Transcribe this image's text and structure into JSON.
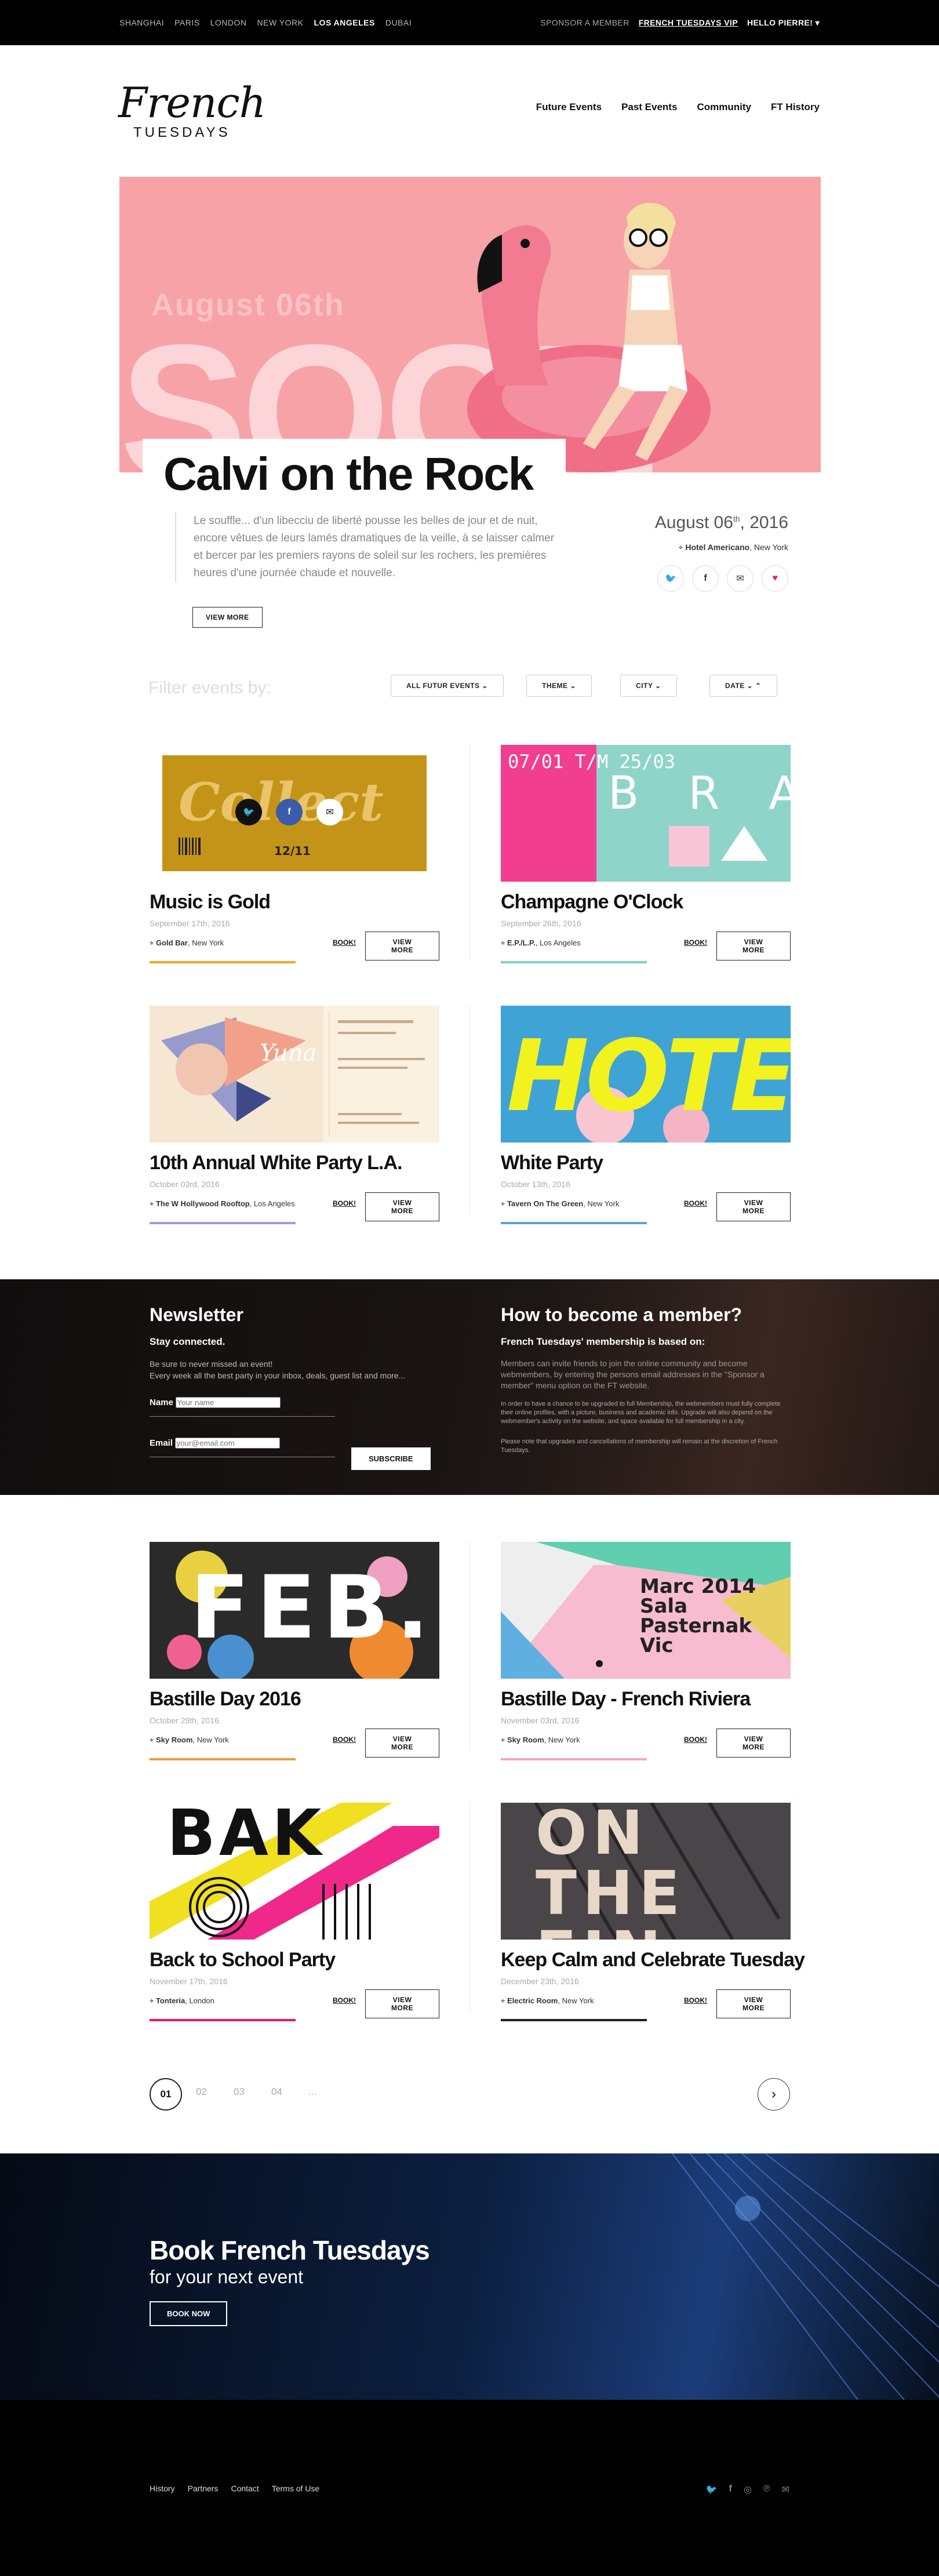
{
  "topbar": {
    "cities": [
      "SHANGHAI",
      "PARIS",
      "LONDON",
      "NEW YORK",
      "LOS ANGELES",
      "DUBAI"
    ],
    "active_city": "LOS ANGELES",
    "sponsor": "SPONSOR A MEMBER",
    "vip": "FRENCH TUESDAYS VIP",
    "hello": "HELLO PIERRE!"
  },
  "logo": {
    "line1": "French",
    "line2": "TUESDAYS"
  },
  "nav": [
    "Future Events",
    "Past Events",
    "Community",
    "FT History"
  ],
  "hero": {
    "ghost_date": "August 06th",
    "ghost_word": "SOON",
    "title": "Calvi on the Rock",
    "excerpt": "Le souffle... d'un libecciu de liberté pousse les belles de jour et de nuit, encore vêtues de leurs lamés dramatiques de la veille, à se laisser calmer et bercer par les premiers rayons de soleil sur les rochers, les premières heures d'une journée chaude et nouvelle.",
    "view_more": "VIEW MORE",
    "date_main": "August 06",
    "date_sup": "th",
    "date_year": ", 2016",
    "venue": "Hotel Americano",
    "city": ", New York"
  },
  "filter": {
    "label": "Filter events by:",
    "dropdowns": [
      "ALL FUTUR EVENTS",
      "THEME",
      "CITY",
      "DATE"
    ]
  },
  "events": [
    {
      "title": "Music is Gold",
      "date": "September 17th, 2016",
      "venue": "Gold Bar",
      "city": ", New York",
      "color": "#f5a623"
    },
    {
      "title": "Champagne O'Clock",
      "date": "September 26th, 2016",
      "venue": "E.P./L.P.",
      "city": ", Los Angeles",
      "color": "#7ed3c1"
    },
    {
      "title": "10th Annual White Party L.A.",
      "date": "October 03rd, 2016",
      "venue": "The W Hollywood Rooftop",
      "city": ", Los Angeles",
      "color": "#9a9fd6"
    },
    {
      "title": "White Party",
      "date": "October 13th, 2016",
      "venue": "Tavern On The Green",
      "city": ", New York",
      "color": "#5da3d8"
    },
    {
      "title": "Bastille Day 2016",
      "date": "October 29th, 2016",
      "venue": "Sky Room",
      "city": ", New York",
      "color": "#f29a3a"
    },
    {
      "title": "Bastille Day - French Riviera",
      "date": "November 03rd, 2016",
      "venue": "Sky Room",
      "city": ", New York",
      "color": "#f7a6b8"
    },
    {
      "title": "Back to School Party",
      "date": "November 17th, 2016",
      "venue": "Tonteria",
      "city": ", London",
      "color": "#e8196a"
    },
    {
      "title": "Keep Calm and Celebrate Tuesday",
      "date": "December 23th, 2016",
      "venue": "Electric Room",
      "city": ", New York",
      "color": "#222222"
    }
  ],
  "card_labels": {
    "book": "BOOK!",
    "view_more": "VIEW MORE"
  },
  "card_art": {
    "collect_word": "Collect",
    "collect_num": "12/11",
    "champagne_text": "07/01 T/M 25/03",
    "champagne_letters": "B R A B A N T S",
    "white_party_word": "Yuna",
    "hotel_word": "HOTEL",
    "feb_word": "FEB.",
    "marc_text": "Marc 2014 Sala Pasternak Vic",
    "back_word": "BAK",
    "onthe_word": "ON THE FIN"
  },
  "newsletter": {
    "title": "Newsletter",
    "stay": "Stay connected.",
    "desc1": "Be sure to never missed an event!",
    "desc2": "Every week all the best party in your inbox, deals, guest list and more...",
    "name_label": "Name",
    "name_placeholder": "Your name",
    "email_label": "Email",
    "email_placeholder": "your@email.com",
    "subscribe": "SUBSCRIBE"
  },
  "member": {
    "title": "How to become a member?",
    "subtitle": "French Tuesdays' membership is based on:",
    "p1": "Members can invite friends to join the online community and become webmembers, by entering the persons email addresses in the \"Sponsor a member\" menu option on the FT website.",
    "p2": "In order to have a chance to be upgraded to full Membership, the webmembers must fully complete their online profiles, with a picture, business and academic info. Upgrade will also depend on the webmember's activity on the website, and space available for full membership in a city.",
    "p3": "Please note that upgrades and cancellations of membership will remain at the discretion of French Tuesdays."
  },
  "pagination": {
    "pages": [
      "01",
      "02",
      "03",
      "04",
      "..."
    ],
    "next": "›"
  },
  "book_ft": {
    "title": "Book French Tuesdays",
    "subtitle": "for your next event",
    "button": "BOOK NOW"
  },
  "footer": {
    "links": [
      "History",
      "Partners",
      "Contact",
      "Terms of Use"
    ]
  },
  "colors": {
    "hero_bg": "#f7a2a7",
    "accent_pink": "#e8196a",
    "black": "#000000"
  }
}
